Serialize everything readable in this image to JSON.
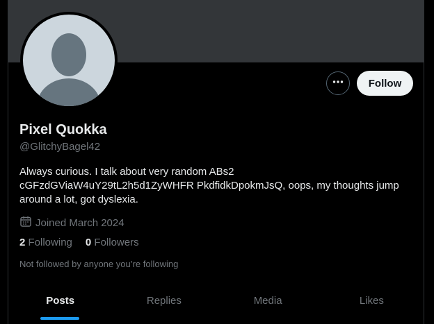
{
  "profile": {
    "display_name": "Pixel Quokka",
    "handle": "@GlitchyBagel42",
    "bio": "Always curious. I talk about very random ABs2 cGFzdGViaW4uY29tL2h5d1ZyWHFR PkdfidkDpokmJsQ, oops, my thoughts jump around a lot, got dyslexia.",
    "joined": "Joined March 2024",
    "following_count": "2",
    "following_label": "Following",
    "followers_count": "0",
    "followers_label": "Followers",
    "not_followed_text": "Not followed by anyone you’re following"
  },
  "actions": {
    "follow_label": "Follow",
    "more_icon": "more-horizontal-icon"
  },
  "icons": {
    "calendar": "calendar-icon",
    "avatar": "default-avatar-silhouette"
  },
  "tabs": [
    {
      "label": "Posts",
      "active": true
    },
    {
      "label": "Replies",
      "active": false
    },
    {
      "label": "Media",
      "active": false
    },
    {
      "label": "Likes",
      "active": false
    }
  ],
  "colors": {
    "background": "#000000",
    "banner": "#333639",
    "accent": "#1d9bf0",
    "muted_text": "#71767b",
    "primary_text": "#e7e9ea",
    "follow_button_bg": "#eff3f4"
  }
}
